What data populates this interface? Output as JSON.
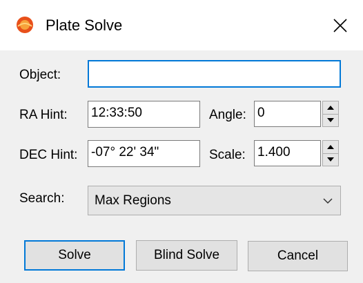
{
  "window": {
    "title": "Plate Solve"
  },
  "fields": {
    "object": {
      "label": "Object:",
      "value": ""
    },
    "ra": {
      "label": "RA Hint:",
      "value": "12:33:50"
    },
    "angle": {
      "label": "Angle:",
      "value": "0"
    },
    "dec": {
      "label": "DEC Hint:",
      "value": "-07° 22' 34\""
    },
    "scale": {
      "label": "Scale:",
      "value": "1.400"
    }
  },
  "search": {
    "label": "Search:",
    "selected": "Max Regions"
  },
  "buttons": {
    "solve": "Solve",
    "blind_solve": "Blind Solve",
    "cancel": "Cancel"
  },
  "colors": {
    "accent": "#0078d7",
    "background": "#f0f0f0",
    "button": "#e1e1e1",
    "icon": "#e8501a"
  },
  "icons": {
    "app": "app-icon",
    "close": "close-icon",
    "spin_up": "arrow-up-icon",
    "spin_down": "arrow-down-icon",
    "dropdown": "chevron-down-icon"
  }
}
